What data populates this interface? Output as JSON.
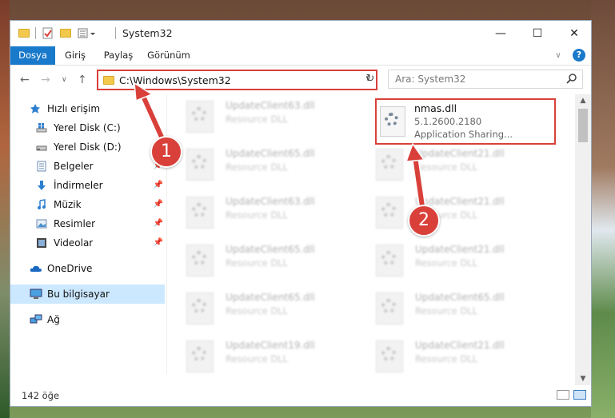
{
  "window": {
    "title": "System32",
    "controls": {
      "minimize": "—",
      "maximize": "☐",
      "close": "✕"
    }
  },
  "ribbon": {
    "tabs": [
      {
        "label": "Dosya",
        "active": true
      },
      {
        "label": "Giriş"
      },
      {
        "label": "Paylaş"
      },
      {
        "label": "Görünüm"
      }
    ],
    "help": "?"
  },
  "address": {
    "path": "C:\\Windows\\System32",
    "search_placeholder": "Ara: System32"
  },
  "sidebar": {
    "items": [
      {
        "label": "Hızlı erişim",
        "icon": "star-icon"
      },
      {
        "label": "Yerel Disk (C:)",
        "icon": "windows-drive-icon"
      },
      {
        "label": "Yerel Disk (D:)",
        "icon": "drive-icon"
      },
      {
        "label": "Belgeler",
        "icon": "documents-icon",
        "pinned": true
      },
      {
        "label": "İndirmeler",
        "icon": "download-icon",
        "pinned": true
      },
      {
        "label": "Müzik",
        "icon": "music-icon",
        "pinned": true
      },
      {
        "label": "Resimler",
        "icon": "pictures-icon",
        "pinned": true
      },
      {
        "label": "Videolar",
        "icon": "video-icon",
        "pinned": true
      },
      {
        "label": "OneDrive",
        "icon": "cloud-icon"
      },
      {
        "label": "Bu bilgisayar",
        "icon": "computer-icon",
        "selected": true
      },
      {
        "label": "Ağ",
        "icon": "network-icon"
      }
    ]
  },
  "files": {
    "left": [
      {
        "name": "UpdateClient63.dll",
        "type": "Resource DLL"
      },
      {
        "name": "UpdateClient65.dll",
        "type": "Resource DLL"
      },
      {
        "name": "UpdateClient63.dll",
        "type": "Resource DLL"
      },
      {
        "name": "UpdateClient65.dll",
        "type": "Resource DLL"
      },
      {
        "name": "UpdateClient65.dll",
        "type": "Resource DLL"
      },
      {
        "name": "UpdateClient19.dll",
        "type": "Resource DLL"
      }
    ],
    "right": [
      {
        "name": "UpdateClient21.dll",
        "type": "Resource DLL"
      },
      {
        "name": "UpdateClient21.dll",
        "type": "Resource DLL"
      },
      {
        "name": "UpdateClient21.dll",
        "type": "Resource DLL"
      },
      {
        "name": "UpdateClient65.dll",
        "type": "Resource DLL"
      },
      {
        "name": "UpdateClient21.dll",
        "type": "Resource DLL"
      }
    ],
    "highlighted": {
      "name": "nmas.dll",
      "version": "5.1.2600.2180",
      "description": "Application Sharing..."
    }
  },
  "status": {
    "count": "142 öğe"
  },
  "callouts": {
    "one": "1",
    "two": "2"
  },
  "colors": {
    "accent": "#1979ca",
    "highlight": "#d9403a",
    "selected": "#cce8ff"
  }
}
